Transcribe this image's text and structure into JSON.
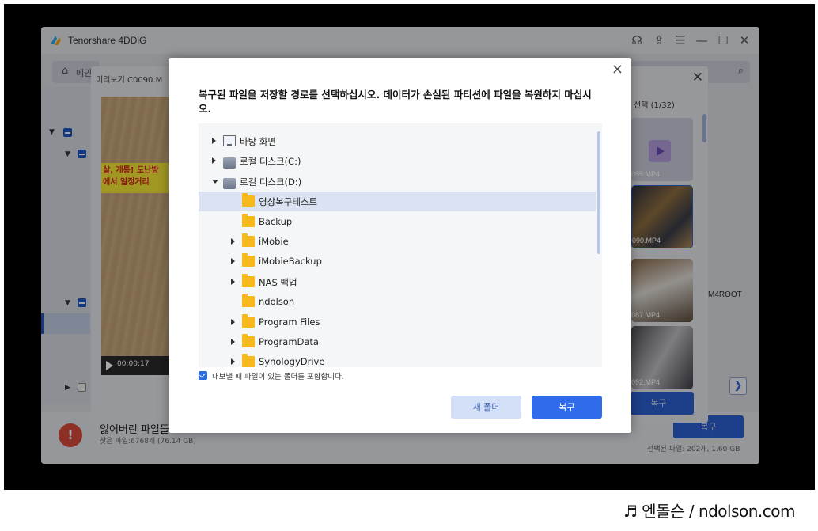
{
  "app": {
    "title": "Tenorshare 4DDiG",
    "nav_tab_label": "메인",
    "lost_files_title": "잃어버린 파일들",
    "found_files": "찾은 파일:6768개 (76.14 GB)",
    "recover_label": "복구",
    "selected_files": "선택된 파일: 202개, 1.60 GB",
    "path_fragment": "M4ROOT"
  },
  "preview": {
    "title": "미리보기  C0090.M",
    "selection_count": "선택 (1/32)",
    "video_time": "00:00:17",
    "sign_line1": "살, 개통! 도난방",
    "sign_line2": "에서 일정거리",
    "thumbnails": [
      {
        "label": "055.MP4",
        "color": "#c9ccd9"
      },
      {
        "label": "090.MP4",
        "color": "#556"
      },
      {
        "label": "087.MP4",
        "color": "#7a6a5a"
      },
      {
        "label": "092.MP4",
        "color": "#6b6d75"
      }
    ],
    "recover_label": "복구"
  },
  "dialog": {
    "heading": "복구된 파일을 저장할 경로를 선택하십시오. 데이터가 손실된 파티션에 파일을 복원하지 마십시오.",
    "tree": [
      {
        "label": "바탕 화면",
        "icon": "desktop-icon",
        "arrow": "right",
        "level": 0
      },
      {
        "label": "로컬 디스크(C:)",
        "icon": "drive-icon",
        "arrow": "right",
        "level": 0
      },
      {
        "label": "로컬 디스크(D:)",
        "icon": "drive-icon",
        "arrow": "down",
        "level": 0
      },
      {
        "label": "영상복구테스트",
        "icon": "folder-icon",
        "arrow": "none",
        "level": 1,
        "selected": true
      },
      {
        "label": "Backup",
        "icon": "folder-icon",
        "arrow": "none",
        "level": 1
      },
      {
        "label": "iMobie",
        "icon": "folder-icon",
        "arrow": "right",
        "level": 1
      },
      {
        "label": "iMobieBackup",
        "icon": "folder-icon",
        "arrow": "right",
        "level": 1
      },
      {
        "label": "NAS 백업",
        "icon": "folder-icon",
        "arrow": "right",
        "level": 1
      },
      {
        "label": "ndolson",
        "icon": "folder-icon",
        "arrow": "none",
        "level": 1
      },
      {
        "label": "Program Files",
        "icon": "folder-icon",
        "arrow": "right",
        "level": 1
      },
      {
        "label": "ProgramData",
        "icon": "folder-icon",
        "arrow": "right",
        "level": 1
      },
      {
        "label": "SynologyDrive",
        "icon": "folder-icon",
        "arrow": "right",
        "level": 1
      }
    ],
    "include_folders_label": "내보낼 때 파일이 있는 폴더를 포함합니다.",
    "include_folders_checked": true,
    "new_folder_label": "새 폴더",
    "recover_label": "복구",
    "close_symbol": "×"
  },
  "watermark": "♬ 엔돌슨 / ndolson.com",
  "colors": {
    "accent": "#2f6bea",
    "folder": "#f6b81b",
    "selected_row": "#dbe3f3"
  }
}
